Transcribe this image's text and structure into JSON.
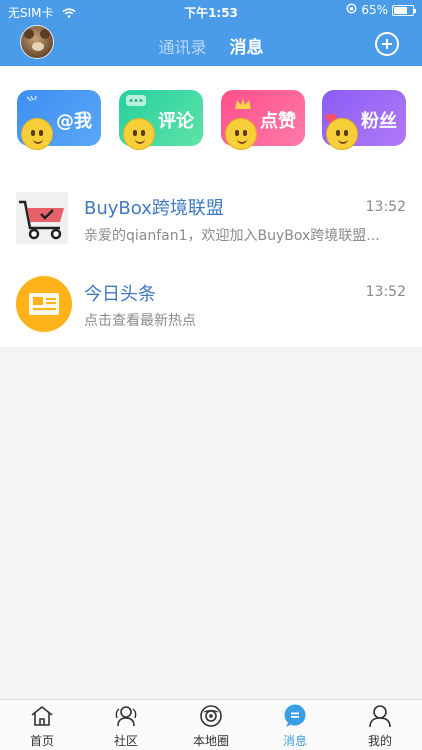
{
  "status_bar": {
    "carrier": "无SIM卡",
    "time": "下午1:53",
    "battery_percent": "65%",
    "battery_level": 0.65
  },
  "header": {
    "tabs": [
      {
        "label": "通讯录",
        "active": false
      },
      {
        "label": "消息",
        "active": true
      }
    ],
    "add_icon": "plus-circle-icon"
  },
  "categories": [
    {
      "label": "@我",
      "gradient": [
        "#3d8ff2",
        "#5aa8f7"
      ],
      "deco": "lightning"
    },
    {
      "label": "评论",
      "gradient": [
        "#26cfa0",
        "#5fe3a7"
      ],
      "deco": "chat-bubble"
    },
    {
      "label": "点赞",
      "gradient": [
        "#ff4f8a",
        "#ff7aa8"
      ],
      "deco": "crown"
    },
    {
      "label": "粉丝",
      "gradient": [
        "#8b5cf6",
        "#b07af7"
      ],
      "deco": "heart"
    }
  ],
  "messages": [
    {
      "title": "BuyBox跨境联盟",
      "time": "13:52",
      "preview": "亲爱的qianfan1，欢迎加入BuyBox跨境联盟...",
      "icon": "shopping-cart-icon"
    },
    {
      "title": "今日头条",
      "time": "13:52",
      "preview": "点击查看最新热点",
      "icon": "newspaper-icon"
    }
  ],
  "tabbar": {
    "items": [
      {
        "label": "首页",
        "icon": "home-icon",
        "active": false
      },
      {
        "label": "社区",
        "icon": "community-icon",
        "active": false
      },
      {
        "label": "本地圈",
        "icon": "local-circle-icon",
        "active": false
      },
      {
        "label": "消息",
        "icon": "message-icon",
        "active": true
      },
      {
        "label": "我的",
        "icon": "profile-icon",
        "active": false
      }
    ]
  },
  "colors": {
    "header_blue": "#4a9be8",
    "active_blue": "#3a9ee6",
    "title_blue": "#3e79c2",
    "news_orange": "#ffb31a"
  }
}
